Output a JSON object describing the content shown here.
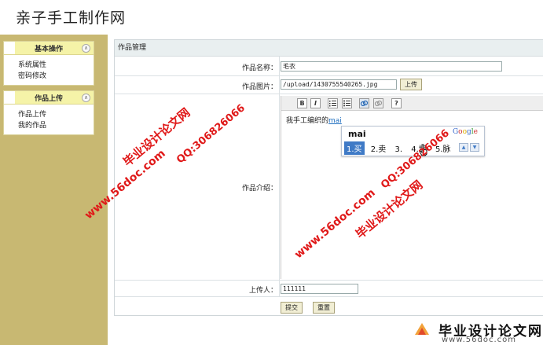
{
  "site": {
    "title": "亲子手工制作网"
  },
  "sidebar": {
    "groups": [
      {
        "title": "基本操作",
        "toggle": "∧",
        "items": [
          "系统属性",
          "密码修改"
        ]
      },
      {
        "title": "作品上传",
        "toggle": "∧",
        "items": [
          "作品上传",
          "我的作品"
        ]
      }
    ]
  },
  "main": {
    "panel_title": "作品管理",
    "form": {
      "name_label": "作品名称：",
      "name_value": "毛衣",
      "image_label": "作品图片：",
      "image_value": "/upload/1430755540265.jpg",
      "upload_button": "上传",
      "intro_label": "作品介绍：",
      "intro_text": "我手工编织的",
      "intro_typing": "mai",
      "uploader_label": "上传人：",
      "uploader_value": "111111",
      "submit_button": "提交",
      "reset_button": "重置"
    },
    "editor_toolbar": {
      "bold": "B",
      "italic": "I",
      "help": "?"
    }
  },
  "ime": {
    "composition": "mai",
    "brand": "Google",
    "candidates": [
      "1.买",
      "2.卖",
      "3.",
      "4.埋",
      "5.脉"
    ],
    "selected_index": 0
  },
  "watermarks": {
    "cn": "毕业设计论文网",
    "url": "www.56doc.com",
    "qq": "QQ:306826066"
  },
  "footer": {
    "name": "毕业设计论文网",
    "url": "www.56doc.com"
  },
  "colors": {
    "sidebar_bg": "#c8b872",
    "menu_head": "#f5f3a8",
    "watermark": "#e01919",
    "ime_selected": "#3f7ac6"
  }
}
